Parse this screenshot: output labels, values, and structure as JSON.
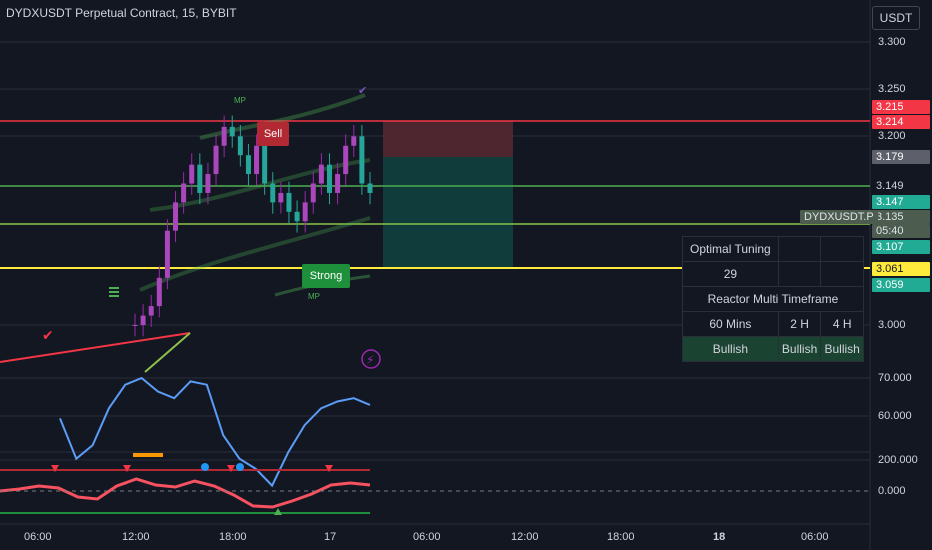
{
  "header": {
    "title": "DYDXUSDT Perpetual Contract, 15, BYBIT",
    "currency_button": "USDT"
  },
  "price_tags": [
    {
      "value": "3.215",
      "bg": "#f23645",
      "fg": "#ffffff"
    },
    {
      "value": "3.214",
      "bg": "#f23645",
      "fg": "#ffffff"
    },
    {
      "value": "3.179",
      "bg": "#5d606b",
      "fg": "#ffffff"
    },
    {
      "value": "3.149",
      "bg": "#131722",
      "fg": "#d1d4dc"
    },
    {
      "value": "3.147",
      "bg": "#22ab94",
      "fg": "#ffffff"
    },
    {
      "value": "3.135",
      "bg": "#4c5c4e",
      "fg": "#e0e3eb"
    },
    {
      "value": "05:40",
      "bg": "#4c5c4e",
      "fg": "#e0e3eb"
    },
    {
      "value": "3.107",
      "bg": "#22ab94",
      "fg": "#ffffff"
    },
    {
      "value": "3.061",
      "bg": "#ffeb3b",
      "fg": "#131722"
    },
    {
      "value": "3.059",
      "bg": "#22ab94",
      "fg": "#ffffff"
    }
  ],
  "ticker_tag": "DYDXUSDT.P",
  "labels": {
    "sell": "Sell",
    "strong": "Strong",
    "mp": "MP"
  },
  "table": {
    "title": "Optimal Tuning",
    "value": "29",
    "subtitle": "Reactor Multi Timeframe",
    "timeframes": [
      "60 Mins",
      "2 H",
      "4 H"
    ],
    "trends": [
      "Bullish",
      "Bullish",
      "Bullish"
    ]
  },
  "chart_data": [
    {
      "type": "line",
      "title": "DYDXUSDT Perpetual Contract, 15, BYBIT",
      "ylabel": "USDT",
      "y_axis": {
        "ticks": [
          "3.300",
          "3.250",
          "3.200",
          "3.000"
        ],
        "range": [
          2.97,
          3.32
        ]
      },
      "x_axis": {
        "ticks": [
          "06:00",
          "12:00",
          "18:00",
          "17",
          "06:00",
          "12:00",
          "18:00",
          "18",
          "06:00"
        ]
      },
      "horizontal_lines": [
        {
          "value": 3.214,
          "color": "#f23645"
        },
        {
          "value": 3.149,
          "color": "#4caf50"
        },
        {
          "value": 3.107,
          "color": "#4caf50"
        },
        {
          "value": 3.061,
          "color": "#ffeb3b"
        }
      ],
      "close_series": [
        3.0,
        3.01,
        3.02,
        3.05,
        3.1,
        3.13,
        3.15,
        3.17,
        3.14,
        3.16,
        3.19,
        3.21,
        3.2,
        3.18,
        3.16,
        3.19,
        3.15,
        3.13,
        3.14,
        3.12,
        3.11,
        3.13,
        3.15,
        3.17,
        3.14,
        3.16,
        3.19,
        3.2,
        3.15,
        3.14
      ],
      "position": {
        "entry": 3.149,
        "stop": 3.214,
        "target": 3.061
      }
    },
    {
      "type": "line",
      "y_axis": {
        "ticks": [
          "70.000",
          "60.000"
        ],
        "range": [
          50,
          72
        ]
      },
      "values": [
        60,
        48,
        52,
        63,
        70,
        72,
        68,
        66,
        71,
        70,
        55,
        48,
        45,
        40,
        50,
        58,
        63,
        65,
        66,
        64
      ]
    },
    {
      "type": "line",
      "y_axis": {
        "ticks": [
          "200.000",
          "0.000"
        ],
        "range": [
          -250,
          250
        ]
      },
      "values": [
        0,
        20,
        50,
        30,
        -60,
        -80,
        50,
        120,
        60,
        40,
        100,
        50,
        -40,
        -150,
        -160,
        -100,
        -30,
        60,
        80,
        60
      ]
    }
  ]
}
